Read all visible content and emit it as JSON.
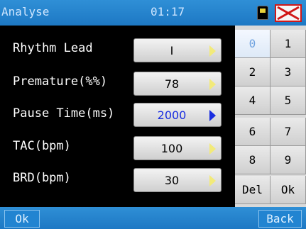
{
  "header": {
    "title": "Analyse",
    "time": "01:17"
  },
  "settings": [
    {
      "label": "Rhythm Lead",
      "value": "I"
    },
    {
      "label": "Premature(%%)",
      "value": "78"
    },
    {
      "label": "Pause Time(ms)",
      "value": "2000"
    },
    {
      "label": "TAC(bpm)",
      "value": "100"
    },
    {
      "label": "BRD(bpm)",
      "value": "30"
    }
  ],
  "keypad": [
    "0",
    "1",
    "2",
    "3",
    "4",
    "5",
    "6",
    "7",
    "8",
    "9",
    "Del",
    "Ok"
  ],
  "footer": {
    "ok_label": "Ok",
    "back_label": "Back"
  },
  "colors": {
    "bar": "#1d78c4",
    "active_value": "#1a2ee0",
    "arrow": "#f2ea7a"
  },
  "icons": {
    "storage": "sd-card-icon",
    "alarm": "alarm-mute-icon"
  }
}
